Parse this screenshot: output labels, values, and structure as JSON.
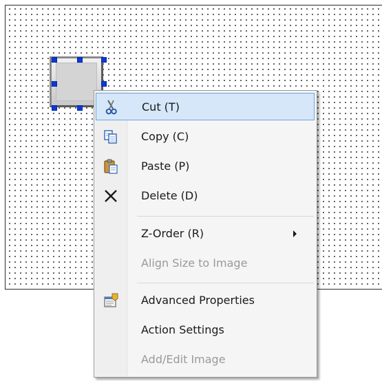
{
  "menu": {
    "items": [
      {
        "label": "Cut (T)",
        "icon": "scissors-icon"
      },
      {
        "label": "Copy (C)",
        "icon": "copy-icon"
      },
      {
        "label": "Paste (P)",
        "icon": "paste-icon"
      },
      {
        "label": "Delete (D)",
        "icon": "delete-x-icon"
      },
      {
        "label": "Z-Order (R)",
        "submenu": true
      },
      {
        "label": "Align Size to Image",
        "disabled": true
      },
      {
        "label": "Advanced Properties",
        "icon": "properties-icon"
      },
      {
        "label": "Action Settings"
      },
      {
        "label": "Add/Edit Image",
        "disabled": true
      }
    ]
  },
  "colors": {
    "hover_bg": "#d5e7f9",
    "hover_border": "#6aa6e0",
    "selection_handle": "#0a3bd6",
    "disabled_text": "#9a9a9a"
  }
}
